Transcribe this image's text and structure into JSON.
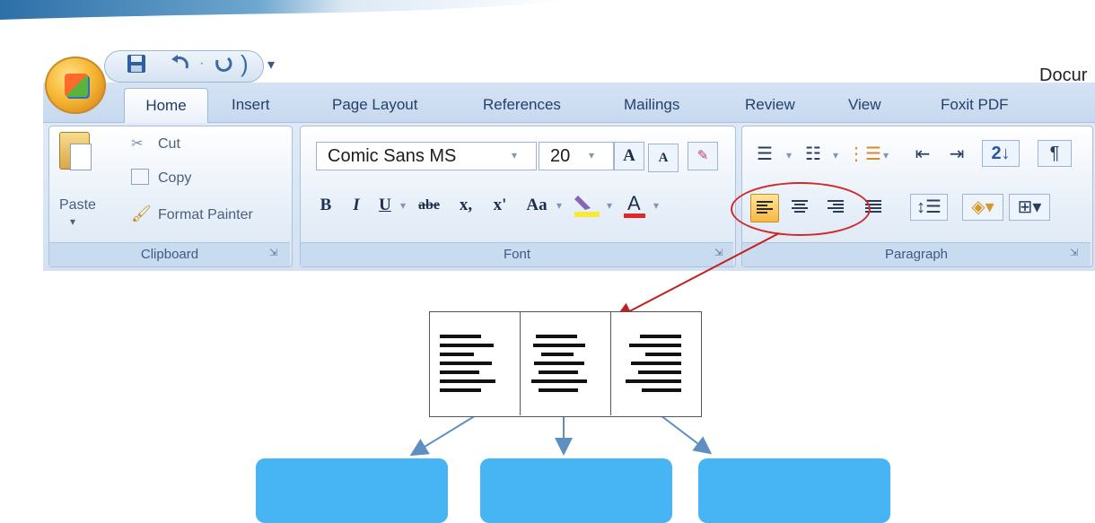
{
  "window": {
    "title_partial": "Docur"
  },
  "quick_access": {
    "save_icon": "save-icon",
    "undo_icon": "undo-icon",
    "redo_icon": "redo-icon",
    "customize": "▾"
  },
  "tabs": [
    "Home",
    "Insert",
    "Page Layout",
    "References",
    "Mailings",
    "Review",
    "View",
    "Foxit PDF"
  ],
  "clipboard": {
    "paste_label": "Paste",
    "paste_arrow": "▾",
    "cut_label": "Cut",
    "copy_label": "Copy",
    "format_painter_label": "Format Painter",
    "group_label": "Clipboard"
  },
  "font": {
    "font_name": "Comic Sans MS",
    "font_size": "20",
    "grow_label": "A",
    "shrink_label": "A",
    "bold": "B",
    "italic": "I",
    "underline": "U",
    "strikethrough": "abe",
    "subscript": "x,",
    "superscript": "x'",
    "change_case": "Aa",
    "group_label": "Font"
  },
  "paragraph": {
    "sort_label": "2↓",
    "pilcrow": "¶",
    "group_label": "Paragraph"
  },
  "colors": {
    "accent_blue": "#47b4f4",
    "highlight_ellipse": "#d22a2a",
    "ribbon_bg": "#dbe7f4"
  },
  "diagram": {
    "cells": [
      "align-left",
      "align-center",
      "align-right"
    ],
    "boxes": [
      "",
      "",
      ""
    ]
  }
}
